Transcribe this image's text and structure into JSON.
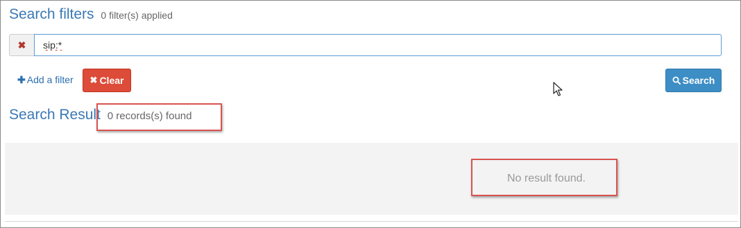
{
  "filters": {
    "title": "Search filters",
    "applied_text": "0 filter(s) applied",
    "query_value": "sip:*",
    "remove_icon": "times-icon",
    "add_filter_label": "Add a filter",
    "clear_label": "Clear",
    "search_label": "Search"
  },
  "results": {
    "title": "Search Result",
    "count_text": "0 records(s) found",
    "empty_text": "No result found."
  },
  "colors": {
    "title_blue": "#3a78b5",
    "clear_red": "#dd4b39",
    "search_blue": "#3d8ec5",
    "highlight_red": "#d9534f"
  }
}
